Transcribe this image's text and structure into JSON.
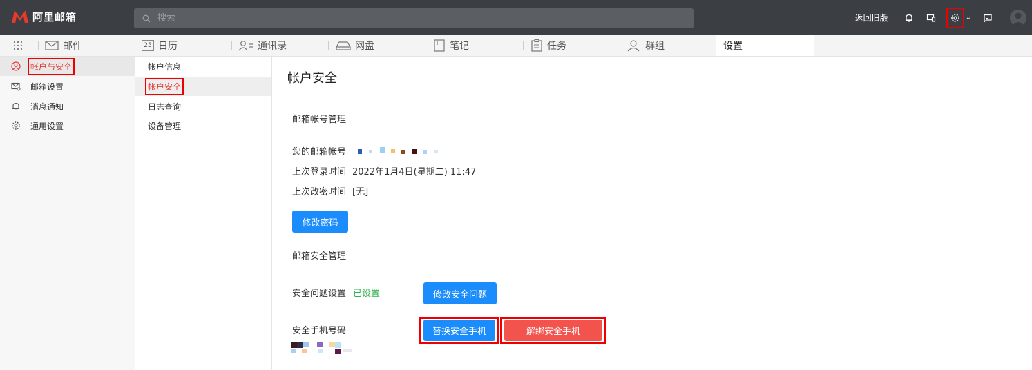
{
  "app": {
    "logo_text": "阿里邮箱"
  },
  "search": {
    "placeholder": "搜索"
  },
  "topbar": {
    "back_old": "返回旧版"
  },
  "nav": {
    "mail": "邮件",
    "calendar": "日历",
    "calendar_day": "25",
    "contacts": "通讯录",
    "drive": "网盘",
    "notes": "笔记",
    "tasks": "任务",
    "groups": "群组",
    "settings": "设置"
  },
  "sidebar": {
    "items": [
      {
        "label": "帐户与安全",
        "icon": "user-circle-icon"
      },
      {
        "label": "邮箱设置",
        "icon": "mail-gear-icon"
      },
      {
        "label": "消息通知",
        "icon": "bell-icon"
      },
      {
        "label": "通用设置",
        "icon": "gear-icon"
      }
    ]
  },
  "subnav": {
    "items": [
      {
        "label": "帐户信息"
      },
      {
        "label": "帐户安全"
      },
      {
        "label": "日志查询"
      },
      {
        "label": "设备管理"
      }
    ]
  },
  "main": {
    "title": "帐户安全",
    "account_section": "邮箱帐号管理",
    "account_label": "您的邮箱帐号",
    "last_login_label": "上次登录时间",
    "last_login_value": "2022年1月4日(星期二) 11:47",
    "last_pwd_label": "上次改密时间",
    "last_pwd_value": "[无]",
    "change_password_btn": "修改密码",
    "security_section": "邮箱安全管理",
    "question_label": "安全问题设置",
    "question_status": "已设置",
    "change_question_btn": "修改安全问题",
    "phone_label": "安全手机号码",
    "replace_phone_btn": "替换安全手机",
    "unbind_phone_btn": "解绑安全手机"
  },
  "colors": {
    "topbar": "#3b3e43",
    "primary_button": "#1a8cfb",
    "danger_button": "#f2544d",
    "status_green": "#2db34a",
    "highlight_box": "#e00000",
    "logo_red": "#e8392f"
  }
}
